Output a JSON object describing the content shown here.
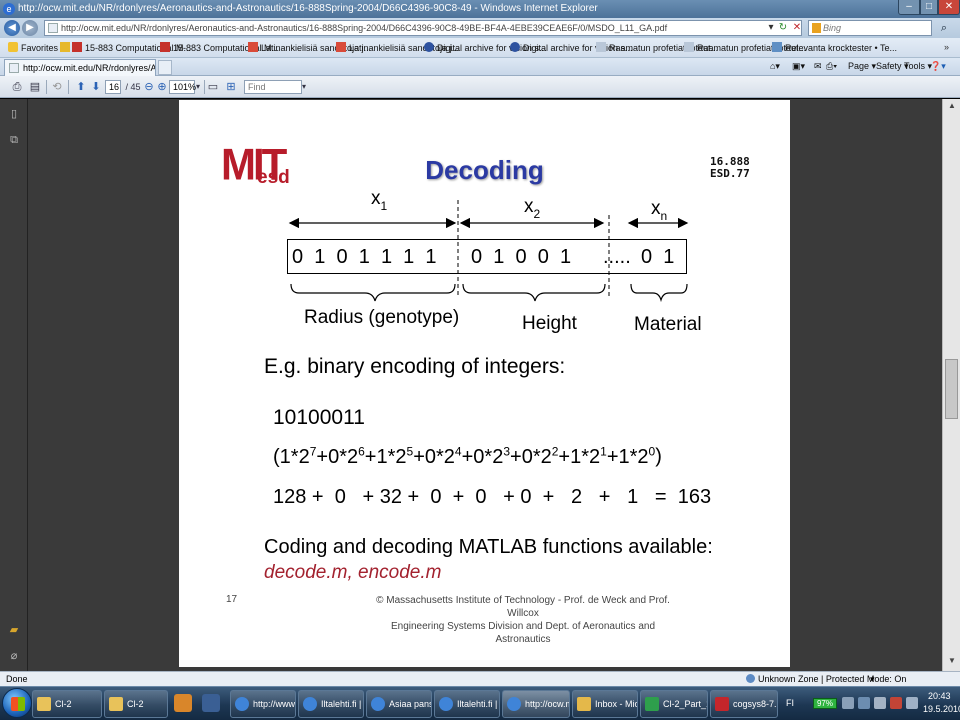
{
  "window": {
    "title": "http://ocw.mit.edu/NR/rdonlyres/Aeronautics-and-Astronautics/16-888Spring-2004/D66C4396-90C8-49 - Windows Internet Explorer",
    "minimize": "–",
    "maximize": "□",
    "close": "✕"
  },
  "address_bar": {
    "url": "http://ocw.mit.edu/NR/rdonlyres/Aeronautics-and-Astronautics/16-888Spring-2004/D66C4396-90C8-49BE-BF4A-4EBE39CEAE6F/0/MSDO_L11_GA.pdf",
    "search_placeholder": "Bing"
  },
  "favorites_bar": {
    "favorites_label": "Favorites",
    "items": [
      "15-883 Computational M...",
      "15-883 Computational M...",
      "Latinankielisiä sanontoja j...",
      "Latinankielisiä sanontoja j...",
      "Digital archive for vision s...",
      "Digital archive for vision s...",
      "Raamatun profetiat toteut...",
      "Raamatun profetiat toteut...",
      "Relevanta krocktester • Te..."
    ]
  },
  "tab": {
    "label": "http://ocw.mit.edu/NR/rdonlyres/Aeronautics-a...",
    "commands": [
      "Page ▾",
      "Safety ▾",
      "Tools ▾"
    ]
  },
  "pdf_toolbar": {
    "page_current": "16",
    "page_total": "/ 45",
    "zoom": "101%",
    "find_placeholder": "Find"
  },
  "slide": {
    "logo_mit": "MIT",
    "logo_esd": "esd",
    "title": "Decoding",
    "course_code_1": "16.888",
    "course_code_2": "ESD.77",
    "x1": "x",
    "x1_sub": "1",
    "x2": "x",
    "x2_sub": "2",
    "xn": "x",
    "xn_sub": "n",
    "bits_group1": "0  1  0  1  1  1  1",
    "bits_group2": "0  1  0  0  1",
    "bits_ellipsis": ".....",
    "bits_group3": "0  1",
    "label_radius": "Radius (genotype)",
    "label_height": "Height",
    "label_material": "Material",
    "example_heading": "E.g. binary encoding of integers:",
    "binary_number": "10100011",
    "expansion_terms": [
      {
        "pre": "(1*2",
        "exp": "7"
      },
      {
        "pre": "+0*2",
        "exp": "6"
      },
      {
        "pre": "+1*2",
        "exp": "5"
      },
      {
        "pre": "+0*2",
        "exp": "4"
      },
      {
        "pre": "+0*2",
        "exp": "3"
      },
      {
        "pre": "+0*2",
        "exp": "2"
      },
      {
        "pre": "+1*2",
        "exp": "1"
      },
      {
        "pre": "+1*2",
        "exp": "0"
      }
    ],
    "expansion_close": ")",
    "sum_line": "128 +  0   + 32 +  0  +  0   + 0  +   2   +   1   =  163",
    "matlab_text": "Coding and decoding MATLAB functions available:",
    "matlab_files": "decode.m, encode.m",
    "slide_number": "17",
    "copyright_line1": "© Massachusetts Institute of Technology - Prof. de Weck and Prof. Willcox",
    "copyright_line2": "Engineering Systems Division and Dept. of Aeronautics and Astronautics"
  },
  "status_bar": {
    "left": "Done",
    "zone": "Unknown Zone | Protected Mode: On",
    "zoom": "▾"
  },
  "taskbar": {
    "tasks": [
      "Cl-2",
      "Cl-2",
      "http://www.c...",
      "Iltalehti.fi | Su...",
      "Asiaa pansuht...",
      "Iltalehti.fi | Su...",
      "http://ocw.mi...",
      "Inbox - Micro...",
      "Cl-2_Part_11",
      "cogsys8-7.pd..."
    ],
    "language": "FI",
    "battery": "97%",
    "time": "20:43",
    "date": "19.5.2010"
  },
  "colors": {
    "mit_red": "#b71c2a",
    "title_blue": "#2b3aa3",
    "matlab_red": "#a3222f"
  }
}
